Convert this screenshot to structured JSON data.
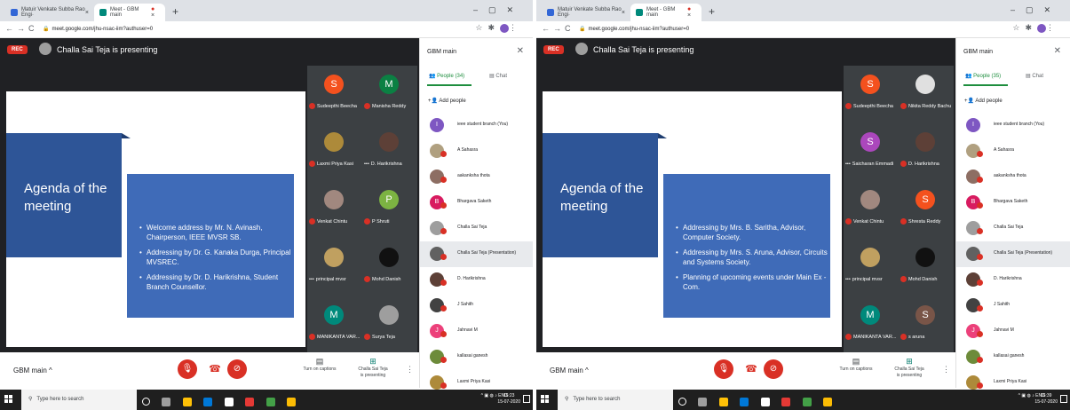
{
  "screens": [
    {
      "browser": {
        "tab1_title": "Matuir Venkate Subba Rao Engi·",
        "tab2_title": "Meet - GBM main",
        "url": "meet.google.com/jhu-nsac-iim?authuser=0"
      },
      "meet": {
        "rec_label": "REC",
        "presenting_text": "Challa Sai Teja is presenting",
        "meeting_name": "GBM main",
        "captions_label": "Turn on captions",
        "presenting_label_line1": "Challa Sai Teja",
        "presenting_label_line2": "is presenting"
      },
      "slide": {
        "title": "Agenda of the meeting",
        "bullets": [
          "Welcome address by Mr. N. Avinash, Chairperson, IEEE MVSR SB.",
          "Addressing by Dr. G. Kanaka Durga, Principal MVSREC.",
          "Addressing by Dr. D. Harikrishna, Student Branch Counsellor."
        ]
      },
      "participants_grid": [
        {
          "name": "Sudeepthi Beecha",
          "initial": "S",
          "color": "#f4511e",
          "indicator": "muted"
        },
        {
          "name": "Manisha Reddy",
          "initial": "M",
          "color": "#0b8043",
          "indicator": "muted"
        },
        {
          "name": "Laxmi Priya Kasi",
          "initial": "",
          "color": "#ad8a3a",
          "indicator": "muted"
        },
        {
          "name": "D. Harikrishna",
          "initial": "",
          "color": "#5d4037",
          "indicator": "speaking"
        },
        {
          "name": "Venkat Chintu",
          "initial": "",
          "color": "#a1887f",
          "indicator": "muted"
        },
        {
          "name": "P Shruti",
          "initial": "P",
          "color": "#7cb342",
          "indicator": "muted"
        },
        {
          "name": "principal mvsr",
          "initial": "",
          "color": "#c0a060",
          "indicator": "speaking"
        },
        {
          "name": "Mohd Danish",
          "initial": "",
          "color": "#111111",
          "indicator": "muted"
        },
        {
          "name": "MANIKANTA VAR...",
          "initial": "M",
          "color": "#00897b",
          "indicator": "muted"
        },
        {
          "name": "Surya Teja",
          "initial": "",
          "color": "#9e9e9e",
          "indicator": "muted"
        }
      ],
      "panel": {
        "title": "GBM main",
        "people_tab": "People (34)",
        "chat_tab": "Chat",
        "add_people": "Add people",
        "people": [
          {
            "name": "ieee student branch (You)",
            "initial": "I",
            "color": "#7e57c2"
          },
          {
            "name": "A Sahasra",
            "initial": "",
            "color": "#b0a080"
          },
          {
            "name": "aakanksha thota",
            "initial": "",
            "color": "#8d6e63"
          },
          {
            "name": "Bhargava Saketh",
            "initial": "B",
            "color": "#d81b60"
          },
          {
            "name": "Challa Sai Teja",
            "initial": "",
            "color": "#9e9e9e"
          },
          {
            "name": "Challa Sai Teja (Presentation)",
            "initial": "",
            "color": "#616161"
          },
          {
            "name": "D. Harikrishna",
            "initial": "",
            "color": "#5d4037"
          },
          {
            "name": "J Sahith",
            "initial": "",
            "color": "#424242"
          },
          {
            "name": "Jahnavi M",
            "initial": "J",
            "color": "#ec407a"
          },
          {
            "name": "kallasai ganesh",
            "initial": "",
            "color": "#6d8b3a"
          },
          {
            "name": "Laxmi Priya Kasi",
            "initial": "",
            "color": "#ad8a3a"
          }
        ]
      },
      "taskbar": {
        "search_placeholder": "Type here to search",
        "tray_lang": "ENG",
        "time": "15:23",
        "date": "15-07-2020"
      }
    },
    {
      "browser": {
        "tab1_title": "Matuir Venkate Subba Rao Engi·",
        "tab2_title": "Meet - GBM main",
        "url": "meet.google.com/jhu-nsac-iim?authuser=0"
      },
      "meet": {
        "rec_label": "REC",
        "presenting_text": "Challa Sai Teja is presenting",
        "meeting_name": "GBM main",
        "captions_label": "Turn on captions",
        "presenting_label_line1": "Challa Sai Teja",
        "presenting_label_line2": "is presenting"
      },
      "slide": {
        "title": "Agenda of the meeting",
        "bullets": [
          "Addressing by Mrs. B. Saritha, Advisor, Computer Society.",
          "Addressing by Mrs. S. Aruna, Advisor, Circuits and Systems Society.",
          "Planning of upcoming events under Main Ex - Com."
        ]
      },
      "participants_grid": [
        {
          "name": "Sudeepthi Beecha",
          "initial": "S",
          "color": "#f4511e",
          "indicator": "muted"
        },
        {
          "name": "Nikita Reddy Bachu",
          "initial": "",
          "color": "#e0e0e0",
          "indicator": "muted"
        },
        {
          "name": "Saicharan Emmadi",
          "initial": "S",
          "color": "#ab47bc",
          "indicator": "speaking"
        },
        {
          "name": "D. Harikrishna",
          "initial": "",
          "color": "#5d4037",
          "indicator": "muted"
        },
        {
          "name": "Venkat Chintu",
          "initial": "",
          "color": "#a1887f",
          "indicator": "muted"
        },
        {
          "name": "Shresta Reddy",
          "initial": "S",
          "color": "#f4511e",
          "indicator": "muted"
        },
        {
          "name": "principal mvsr",
          "initial": "",
          "color": "#c0a060",
          "indicator": "speaking"
        },
        {
          "name": "Mohd Danish",
          "initial": "",
          "color": "#111111",
          "indicator": "muted"
        },
        {
          "name": "MANIKANTA VAR...",
          "initial": "M",
          "color": "#00897b",
          "indicator": "muted"
        },
        {
          "name": "s aruna",
          "initial": "S",
          "color": "#795548",
          "indicator": "muted"
        }
      ],
      "panel": {
        "title": "GBM main",
        "people_tab": "People (35)",
        "chat_tab": "Chat",
        "add_people": "Add people",
        "people": [
          {
            "name": "ieee student branch (You)",
            "initial": "I",
            "color": "#7e57c2"
          },
          {
            "name": "A Sahasra",
            "initial": "",
            "color": "#b0a080"
          },
          {
            "name": "aakanksha thota",
            "initial": "",
            "color": "#8d6e63"
          },
          {
            "name": "Bhargava Saketh",
            "initial": "B",
            "color": "#d81b60"
          },
          {
            "name": "Challa Sai Teja",
            "initial": "",
            "color": "#9e9e9e"
          },
          {
            "name": "Challa Sai Teja (Presentation)",
            "initial": "",
            "color": "#616161"
          },
          {
            "name": "D. Harikrishna",
            "initial": "",
            "color": "#5d4037"
          },
          {
            "name": "J Sahith",
            "initial": "",
            "color": "#424242"
          },
          {
            "name": "Jahnavi M",
            "initial": "J",
            "color": "#ec407a"
          },
          {
            "name": "kallasai ganesh",
            "initial": "",
            "color": "#6d8b3a"
          },
          {
            "name": "Laxmi Priya Kasi",
            "initial": "",
            "color": "#ad8a3a"
          }
        ]
      },
      "taskbar": {
        "search_placeholder": "Type here to search",
        "tray_lang": "ENG",
        "time": "15:39",
        "date": "15-07-2020"
      }
    }
  ]
}
